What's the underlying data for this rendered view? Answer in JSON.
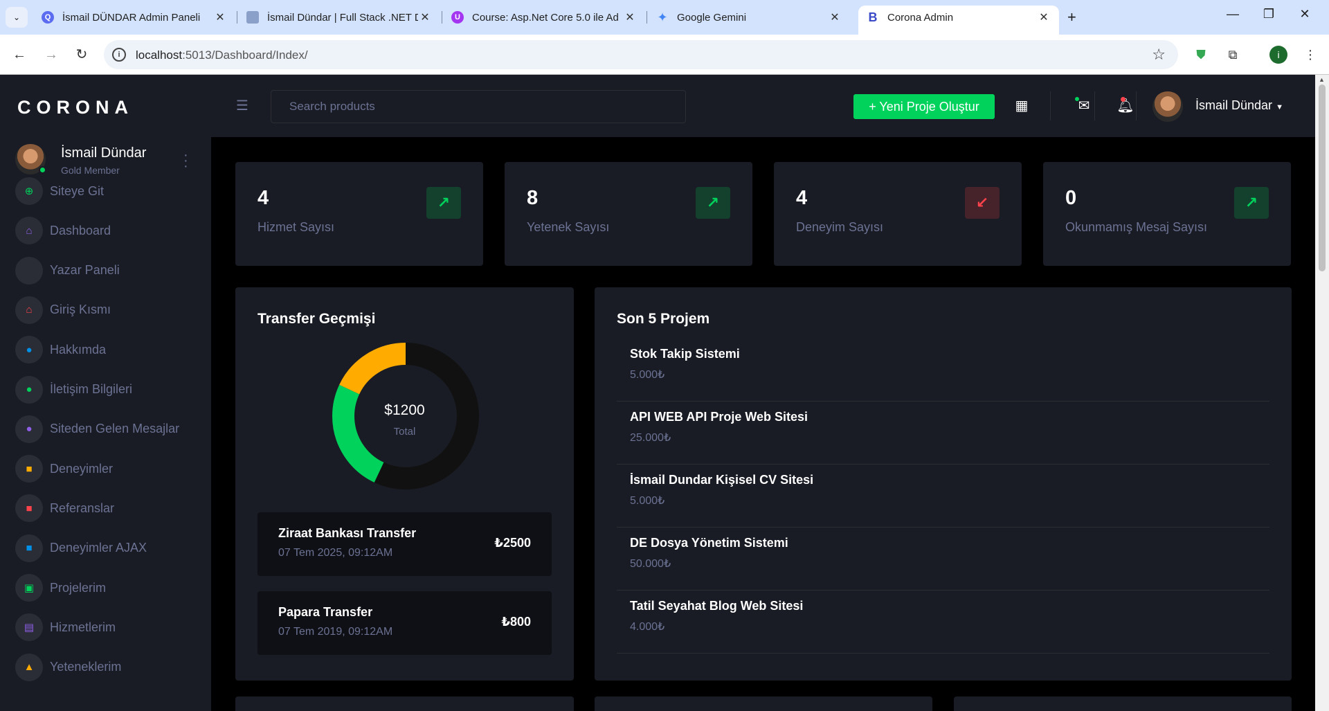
{
  "browser": {
    "tabs": [
      {
        "title": "İsmail DÜNDAR Admin Paneli",
        "icon": "search-favicon"
      },
      {
        "title": "İsmail Dündar | Full Stack .NET D",
        "icon": "document-favicon"
      },
      {
        "title": "Course: Asp.Net Core 5.0 ile Ad",
        "icon": "udemy-favicon"
      },
      {
        "title": "Google Gemini",
        "icon": "gemini-favicon"
      },
      {
        "title": "Corona Admin",
        "icon": "bootstrap-favicon"
      }
    ],
    "url_host": "localhost",
    "url_path": ":5013/Dashboard/Index/",
    "profile_initial": "i"
  },
  "sidebar": {
    "brand": "CORONA",
    "user_name": "İsmail Dündar",
    "user_role": "Gold Member",
    "items": [
      {
        "label": "Siteye Git",
        "icon": "globe-icon",
        "color": "#00d25b"
      },
      {
        "label": "Dashboard",
        "icon": "home-icon",
        "color": "#8f5fe8"
      },
      {
        "label": "Yazar Paneli",
        "icon": "blank-icon",
        "color": "#2a2d36"
      },
      {
        "label": "Giriş Kısmı",
        "icon": "home-icon",
        "color": "#fc424a"
      },
      {
        "label": "Hakkımda",
        "icon": "user-icon",
        "color": "#0090e7"
      },
      {
        "label": "İletişim Bilgileri",
        "icon": "user-icon",
        "color": "#00d25b"
      },
      {
        "label": "Siteden Gelen Mesajlar",
        "icon": "user-icon",
        "color": "#8f5fe8"
      },
      {
        "label": "Deneyimler",
        "icon": "briefcase-icon",
        "color": "#ffab00"
      },
      {
        "label": "Referanslar",
        "icon": "briefcase-icon",
        "color": "#fc424a"
      },
      {
        "label": "Deneyimler AJAX",
        "icon": "briefcase-icon",
        "color": "#0090e7"
      },
      {
        "label": "Projelerim",
        "icon": "image-icon",
        "color": "#00d25b"
      },
      {
        "label": "Hizmetlerim",
        "icon": "clipboard-icon",
        "color": "#8f5fe8"
      },
      {
        "label": "Yeteneklerim",
        "icon": "graduation-cap-icon",
        "color": "#ffab00"
      }
    ]
  },
  "topnav": {
    "search_placeholder": "Search products",
    "new_project_label": "+ Yeni Proje Oluştur",
    "user_name": "İsmail Dündar"
  },
  "stats": [
    {
      "value": "4",
      "label": "Hizmet Sayısı",
      "trend": "up"
    },
    {
      "value": "8",
      "label": "Yetenek Sayısı",
      "trend": "up"
    },
    {
      "value": "4",
      "label": "Deneyim Sayısı",
      "trend": "down"
    },
    {
      "value": "0",
      "label": "Okunmamış Mesaj Sayısı",
      "trend": "up"
    }
  ],
  "transfer": {
    "title": "Transfer Geçmişi",
    "total_value": "$1200",
    "total_label": "Total",
    "donut": [
      {
        "color": "#111111",
        "fraction": 0.57
      },
      {
        "color": "#00d25b",
        "fraction": 0.25
      },
      {
        "color": "#ffab00",
        "fraction": 0.18
      }
    ],
    "items": [
      {
        "name": "Ziraat Bankası Transfer",
        "date": "07 Tem 2025, 09:12AM",
        "amount": "₺2500"
      },
      {
        "name": "Papara Transfer",
        "date": "07 Tem 2019, 09:12AM",
        "amount": "₺800"
      }
    ]
  },
  "projects": {
    "title": "Son 5 Projem",
    "items": [
      {
        "name": "Stok Takip Sistemi",
        "price": "5.000₺"
      },
      {
        "name": "API WEB API Proje Web Sitesi",
        "price": "25.000₺"
      },
      {
        "name": "İsmail Dundar Kişisel CV Sitesi",
        "price": "5.000₺"
      },
      {
        "name": "DE Dosya Yönetim Sistemi",
        "price": "50.000₺"
      },
      {
        "name": "Tatil Seyahat Blog Web Sitesi",
        "price": "4.000₺"
      }
    ]
  }
}
